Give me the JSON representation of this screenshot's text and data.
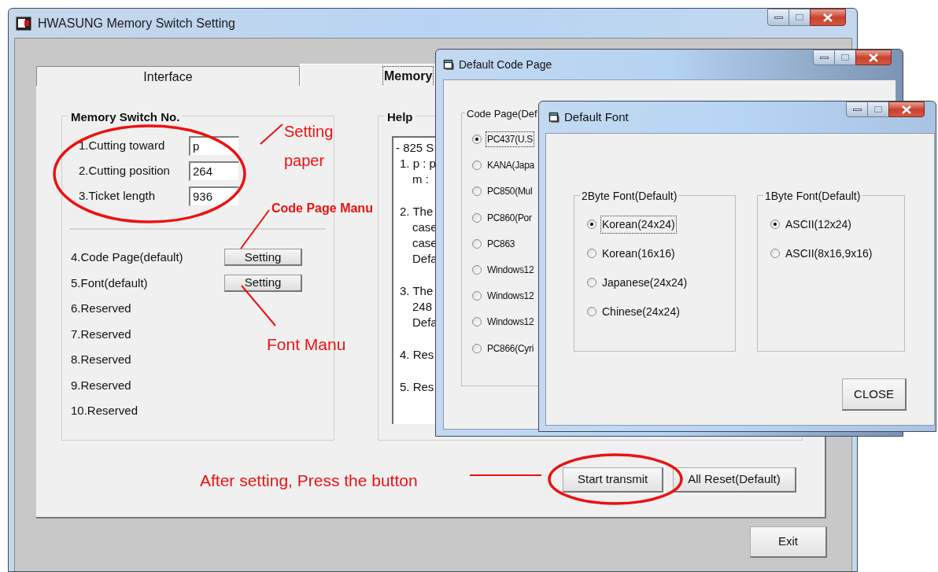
{
  "main_window": {
    "title": "HWASUNG Memory Switch Setting",
    "tabs": [
      {
        "label": "Interface",
        "selected": false
      },
      {
        "label": "Memory",
        "selected": true
      }
    ],
    "memory_switch_group": {
      "title": "Memory Switch No.",
      "fields": [
        {
          "label": "1.Cutting toward",
          "value": "p"
        },
        {
          "label": "2.Cutting position",
          "value": "264"
        },
        {
          "label": "3.Ticket length",
          "value": "936"
        }
      ],
      "items": [
        {
          "label": "4.Code Page(default)",
          "button": "Setting"
        },
        {
          "label": "5.Font(default)",
          "button": "Setting"
        },
        {
          "label": "6.Reserved"
        },
        {
          "label": "7.Reserved"
        },
        {
          "label": "8.Reserved"
        },
        {
          "label": "9.Reserved"
        },
        {
          "label": "10.Reserved"
        }
      ]
    },
    "help_group": {
      "title": "Help",
      "heading": "- 825 S",
      "entries": [
        {
          "text": "1. p : p",
          "continuation": [
            "m :"
          ]
        },
        {
          "text": "2. The",
          "continuation": [
            "case",
            "case",
            "Defa"
          ]
        },
        {
          "text": "3. The",
          "continuation": [
            "248",
            "Defa"
          ]
        },
        {
          "text": "4. Res"
        },
        {
          "text": "5. Res"
        }
      ]
    },
    "buttons": [
      "Start transmit",
      "All Reset(Default)"
    ],
    "exit_button": "Exit"
  },
  "code_page_dialog": {
    "title": "Default Code Page",
    "group_title": "Code Page(Def",
    "options": [
      {
        "label": "PC437(U.S",
        "selected": true,
        "focused": true
      },
      {
        "label": "KANA(Japa",
        "selected": false,
        "focused": false
      },
      {
        "label": "PC850(Mul",
        "selected": false,
        "focused": false
      },
      {
        "label": "PC860(Por",
        "selected": false,
        "focused": false
      },
      {
        "label": "PC863",
        "selected": false,
        "focused": false
      },
      {
        "label": "Windows12",
        "selected": false,
        "focused": false
      },
      {
        "label": "Windows12",
        "selected": false,
        "focused": false
      },
      {
        "label": "Windows12",
        "selected": false,
        "focused": false
      },
      {
        "label": "PC866(Cyri",
        "selected": false,
        "focused": false
      }
    ]
  },
  "font_dialog": {
    "title": "Default Font",
    "groups": [
      {
        "title": "2Byte Font(Default)",
        "options": [
          {
            "label": "Korean(24x24)",
            "selected": true,
            "focused": true
          },
          {
            "label": "Korean(16x16)",
            "selected": false,
            "focused": false
          },
          {
            "label": "Japanese(24x24)",
            "selected": false,
            "focused": false
          },
          {
            "label": "Chinese(24x24)",
            "selected": false,
            "focused": false
          }
        ]
      },
      {
        "title": "1Byte Font(Default)",
        "options": [
          {
            "label": "ASCII(12x24)",
            "selected": true,
            "focused": false
          },
          {
            "label": "ASCII(8x16,9x16)",
            "selected": false,
            "focused": false
          }
        ]
      }
    ],
    "close_button": "CLOSE"
  },
  "annotations": [
    {
      "kind": "normal",
      "text": "Setting"
    },
    {
      "kind": "normal",
      "text": "paper"
    },
    {
      "kind": "bold",
      "text": "Code Page Manu"
    },
    {
      "kind": "normal",
      "text": "Font Manu"
    },
    {
      "kind": "normal",
      "text": "After setting, Press the button"
    }
  ]
}
